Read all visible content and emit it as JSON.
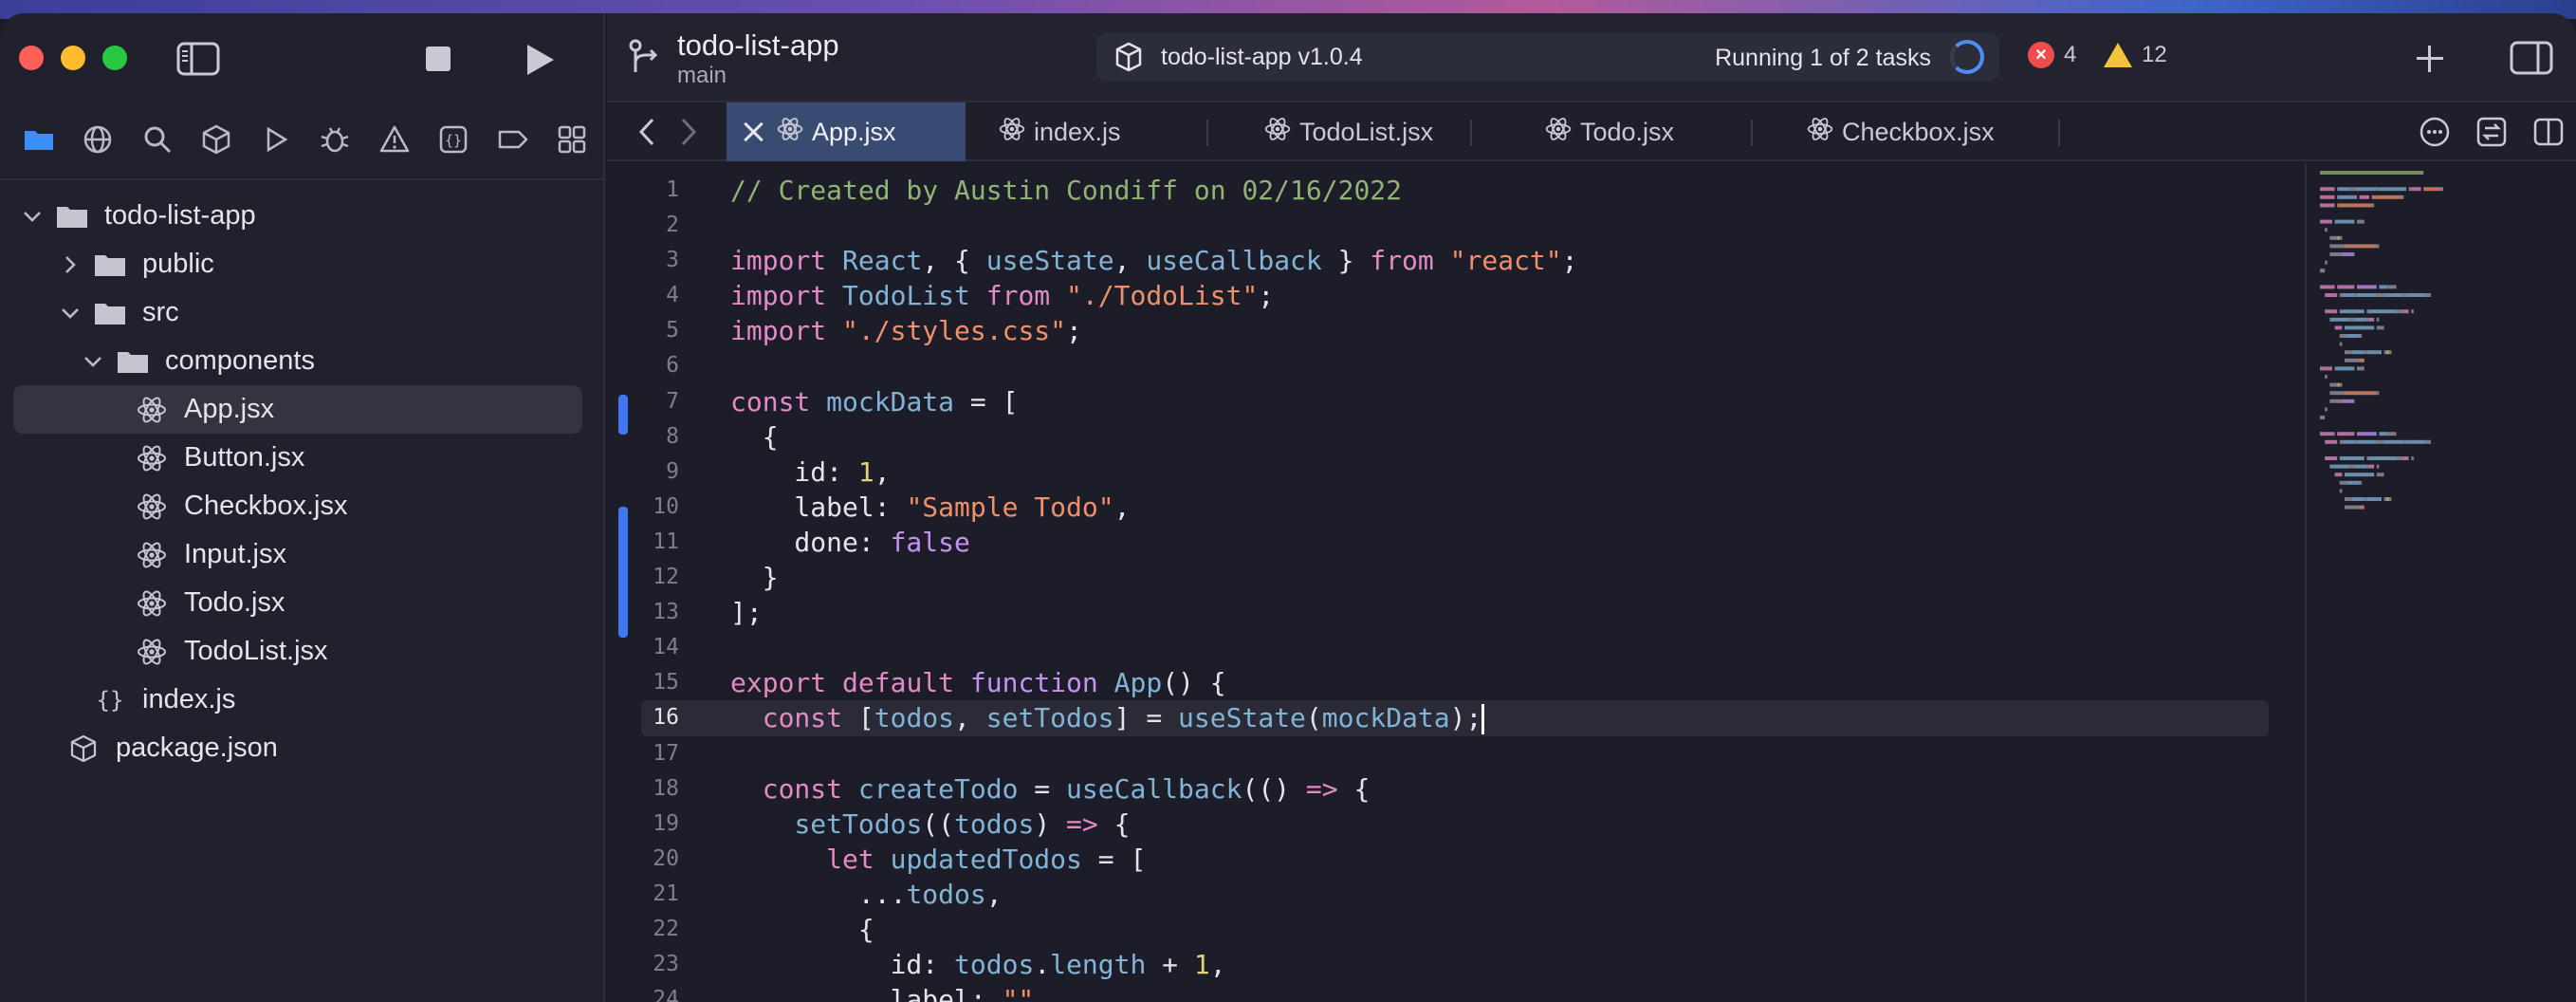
{
  "window": {
    "project_title": "todo-list-app",
    "branch": "main"
  },
  "activity": {
    "scheme": "todo-list-app v1.0.4",
    "status": "Running 1 of 2 tasks",
    "errors": "4",
    "warnings": "12"
  },
  "sidebar": {
    "nav_icons": [
      "folder-icon",
      "globe-icon",
      "search-icon",
      "cube-icon",
      "play-outline-icon",
      "bug-icon",
      "warning-icon",
      "braces-icon",
      "tag-icon",
      "grid-icon"
    ],
    "tree": [
      {
        "label": "todo-list-app",
        "type": "folder",
        "depth": 0,
        "expanded": true
      },
      {
        "label": "public",
        "type": "folder",
        "depth": 1,
        "expanded": false
      },
      {
        "label": "src",
        "type": "folder",
        "depth": 1,
        "expanded": true
      },
      {
        "label": "components",
        "type": "folder",
        "depth": 2,
        "expanded": true
      },
      {
        "label": "App.jsx",
        "type": "react",
        "depth": 3,
        "selected": true
      },
      {
        "label": "Button.jsx",
        "type": "react",
        "depth": 3
      },
      {
        "label": "Checkbox.jsx",
        "type": "react",
        "depth": 3
      },
      {
        "label": "Input.jsx",
        "type": "react",
        "depth": 3
      },
      {
        "label": "Todo.jsx",
        "type": "react",
        "depth": 3
      },
      {
        "label": "TodoList.jsx",
        "type": "react",
        "depth": 3
      },
      {
        "label": "index.js",
        "type": "js",
        "depth": 2
      },
      {
        "label": "package.json",
        "type": "package",
        "depth": 1
      }
    ]
  },
  "tabs": [
    {
      "label": "App.jsx",
      "active": true
    },
    {
      "label": "index.js"
    },
    {
      "label": "TodoList.jsx"
    },
    {
      "label": "Todo.jsx"
    },
    {
      "label": "Checkbox.jsx"
    }
  ],
  "editor": {
    "current_line": 16,
    "lines": [
      {
        "n": "1",
        "tokens": [
          [
            "cm",
            "// Created by Austin Condiff on 02/16/2022"
          ]
        ]
      },
      {
        "n": "2",
        "tokens": []
      },
      {
        "n": "3",
        "tokens": [
          [
            "kw",
            "import"
          ],
          [
            "pl",
            " "
          ],
          [
            "fn",
            "React"
          ],
          [
            "pl",
            ", { "
          ],
          [
            "fn",
            "useState"
          ],
          [
            "pl",
            ", "
          ],
          [
            "fn",
            "useCallback"
          ],
          [
            "pl",
            " } "
          ],
          [
            "kw",
            "from"
          ],
          [
            "pl",
            " "
          ],
          [
            "str",
            "\"react\""
          ],
          [
            "pl",
            ";"
          ]
        ]
      },
      {
        "n": "4",
        "tokens": [
          [
            "kw",
            "import"
          ],
          [
            "pl",
            " "
          ],
          [
            "fn",
            "TodoList"
          ],
          [
            "pl",
            " "
          ],
          [
            "kw",
            "from"
          ],
          [
            "pl",
            " "
          ],
          [
            "str",
            "\"./TodoList\""
          ],
          [
            "pl",
            ";"
          ]
        ]
      },
      {
        "n": "5",
        "tokens": [
          [
            "kw",
            "import"
          ],
          [
            "pl",
            " "
          ],
          [
            "str",
            "\"./styles.css\""
          ],
          [
            "pl",
            ";"
          ]
        ]
      },
      {
        "n": "6",
        "tokens": []
      },
      {
        "n": "7",
        "tokens": [
          [
            "kw",
            "const"
          ],
          [
            "pl",
            " "
          ],
          [
            "fn",
            "mockData"
          ],
          [
            "pl",
            " = ["
          ]
        ]
      },
      {
        "n": "8",
        "tokens": [
          [
            "pl",
            "  {"
          ]
        ]
      },
      {
        "n": "9",
        "tokens": [
          [
            "pl",
            "    id: "
          ],
          [
            "num",
            "1"
          ],
          [
            "pl",
            ","
          ]
        ]
      },
      {
        "n": "10",
        "tokens": [
          [
            "pl",
            "    label: "
          ],
          [
            "str",
            "\"Sample Todo\""
          ],
          [
            "pl",
            ","
          ]
        ]
      },
      {
        "n": "11",
        "tokens": [
          [
            "pl",
            "    done: "
          ],
          [
            "kw2",
            "false"
          ]
        ]
      },
      {
        "n": "12",
        "tokens": [
          [
            "pl",
            "  }"
          ]
        ]
      },
      {
        "n": "13",
        "tokens": [
          [
            "pl",
            "];"
          ]
        ]
      },
      {
        "n": "14",
        "tokens": []
      },
      {
        "n": "15",
        "tokens": [
          [
            "kw",
            "export"
          ],
          [
            "pl",
            " "
          ],
          [
            "kw",
            "default"
          ],
          [
            "pl",
            " "
          ],
          [
            "kw2",
            "function"
          ],
          [
            "pl",
            " "
          ],
          [
            "fn",
            "App"
          ],
          [
            "pl",
            "() {"
          ]
        ]
      },
      {
        "n": "16",
        "tokens": [
          [
            "pl",
            "  "
          ],
          [
            "kw",
            "const"
          ],
          [
            "pl",
            " ["
          ],
          [
            "fn",
            "todos"
          ],
          [
            "pl",
            ", "
          ],
          [
            "fn",
            "setTodos"
          ],
          [
            "pl",
            "] = "
          ],
          [
            "fn",
            "useState"
          ],
          [
            "pl",
            "("
          ],
          [
            "fn",
            "mockData"
          ],
          [
            "pl",
            ");"
          ]
        ]
      },
      {
        "n": "17",
        "tokens": []
      },
      {
        "n": "18",
        "tokens": [
          [
            "pl",
            "  "
          ],
          [
            "kw",
            "const"
          ],
          [
            "pl",
            " "
          ],
          [
            "fn",
            "createTodo"
          ],
          [
            "pl",
            " = "
          ],
          [
            "fn",
            "useCallback"
          ],
          [
            "pl",
            "(() "
          ],
          [
            "kw",
            "=>"
          ],
          [
            "pl",
            " {"
          ]
        ]
      },
      {
        "n": "19",
        "tokens": [
          [
            "pl",
            "    "
          ],
          [
            "fn",
            "setTodos"
          ],
          [
            "pl",
            "(("
          ],
          [
            "fn",
            "todos"
          ],
          [
            "pl",
            ") "
          ],
          [
            "kw",
            "=>"
          ],
          [
            "pl",
            " {"
          ]
        ]
      },
      {
        "n": "20",
        "tokens": [
          [
            "pl",
            "      "
          ],
          [
            "kw",
            "let"
          ],
          [
            "pl",
            " "
          ],
          [
            "fn",
            "updatedTodos"
          ],
          [
            "pl",
            " = ["
          ]
        ]
      },
      {
        "n": "21",
        "tokens": [
          [
            "pl",
            "        ..."
          ],
          [
            "fn",
            "todos"
          ],
          [
            "pl",
            ","
          ]
        ]
      },
      {
        "n": "22",
        "tokens": [
          [
            "pl",
            "        {"
          ]
        ]
      },
      {
        "n": "23",
        "tokens": [
          [
            "pl",
            "          id: "
          ],
          [
            "fn",
            "todos"
          ],
          [
            "pl",
            "."
          ],
          [
            "fn",
            "length"
          ],
          [
            "pl",
            " + "
          ],
          [
            "num",
            "1"
          ],
          [
            "pl",
            ","
          ]
        ]
      },
      {
        "n": "24",
        "tokens": [
          [
            "pl",
            "          label: "
          ],
          [
            "str",
            "\"\""
          ]
        ]
      }
    ]
  },
  "colors": {
    "accent_blue": "#3f78f0",
    "error_red": "#ee4c4f",
    "warning_yellow": "#f5c33b"
  }
}
